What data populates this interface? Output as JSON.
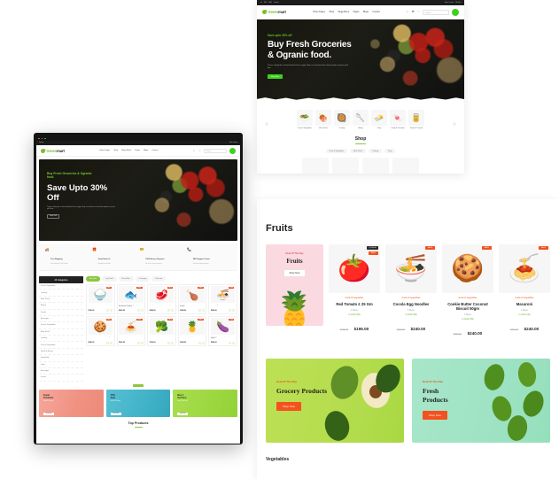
{
  "panel_top": {
    "topbar": {
      "left_items": [
        "en",
        "USD",
        "FAQ",
        "Contact"
      ],
      "right_items": [
        "Store Locator",
        "Wishlist"
      ]
    },
    "nav": {
      "brand": {
        "g": "Green",
        "rest": "mart",
        "icon": "leaf-icon"
      },
      "links": [
        "Home Pages",
        "Shop",
        "Mega Menu",
        "Pages",
        "Blogs",
        "Contact"
      ],
      "search_placeholder": "Search...",
      "icons": [
        "search-icon",
        "compare-icon",
        "wishlist-icon",
        "cart-icon"
      ]
    },
    "hero": {
      "kicker": "Save upto 30% off",
      "title": "Buy Fresh Groceries\n& Ogranic food.",
      "sub": "There's nothing like a vibrant flavorful fruit or veggie. Shop our selection of farm fresh produce at prices you'll love.",
      "button": "Shop Now"
    },
    "categories": [
      {
        "label": "Fruits &\nVegetables",
        "icon": "🥗"
      },
      {
        "label": "Meat & Fish",
        "icon": "🍖"
      },
      {
        "label": "Cooking",
        "icon": "🥘"
      },
      {
        "label": "Baking",
        "icon": "🥄"
      },
      {
        "label": "Dairy",
        "icon": "🧈"
      },
      {
        "label": "Candy &\nChocolate",
        "icon": "🍬"
      },
      {
        "label": "Frozen & Canned",
        "icon": "🥫"
      }
    ],
    "shop": {
      "title": "Shop",
      "pills": [
        "Fruits & Vegetables",
        "Meat & Fish",
        "Cooking",
        "Dairy"
      ]
    }
  },
  "panel_fruits": {
    "heading": "Fruits",
    "deal_card": {
      "kicker": "Deal Of The Day",
      "title": "Fruits",
      "button": "Shop Now",
      "art": "🍍"
    },
    "products": [
      {
        "category": "Fruits & Vegetables",
        "name": "Red Tomato  £ 25 Gm",
        "unit": "1 Piece",
        "stock": "In stock (25)",
        "old_price": "$245.00",
        "price": "$195.00",
        "badge_timer": "12:45:06",
        "badge_sale": "SALE",
        "icon": "🍅"
      },
      {
        "category": "Fruits & Vegetables",
        "name": "Cocola Egg Noodles",
        "unit": "1 Piece",
        "stock": "In stock (80)",
        "old_price": "$290.00",
        "price": "$240.00",
        "badge_sale": "SALE",
        "icon": "🍜"
      },
      {
        "category": "Fruits & Vegetables",
        "name": "Cookie Butter Coconut Biscuit 50gm",
        "unit": "1 Piece",
        "stock": "In stock (99)",
        "old_price": "$290.00",
        "price": "$240.00",
        "badge_sale": "SALE",
        "icon": "🍪"
      },
      {
        "category": "Fruits & Vegetables",
        "name": "Macaroni",
        "unit": "1 Piece",
        "stock": "In stock (40)",
        "old_price": "$290.00",
        "price": "$240.00",
        "badge_sale": "SALE",
        "icon": "🍝"
      }
    ],
    "banners": [
      {
        "kicker": "Deal Of The Day",
        "title": "Grocery Products",
        "button": "Shop Now",
        "theme": "green"
      },
      {
        "kicker": "Deal Of The Day",
        "title": "Fresh\nProducts",
        "button": "Shop Now",
        "theme": "mint"
      }
    ],
    "footer_heading": "Vegetables"
  },
  "panel_laptop": {
    "topbar": {
      "left_items": [
        "en",
        "USD",
        "FAQ",
        "Contact"
      ],
      "right_items": [
        "Store Locator",
        "Wishlist"
      ]
    },
    "nav": {
      "brand": {
        "g": "Green",
        "rest": "mart",
        "icon": "leaf-icon"
      },
      "links": [
        "Home Pages",
        "Shop",
        "Mega Menu",
        "Pages",
        "Blogs",
        "Contact"
      ],
      "search_placeholder": "Search..."
    },
    "hero": {
      "kicker": "Buy Fresh Groceries & Ogranic\nfood.",
      "title": "Save Upto 30%\nOff",
      "sub": "There's nothing like a vibrant flavorful fruit or veggie. Shop our selection of farm fresh produce at prices you'll love.",
      "button": "Shop Now"
    },
    "features": [
      {
        "icon": "🚚",
        "title": "Free Shipping",
        "sub": "Free shipping on all US order"
      },
      {
        "icon": "🎁",
        "title": "Great Deals of",
        "sub": "Everyday fresh deals"
      },
      {
        "icon": "💳",
        "title": "100% Secure Payment",
        "sub": "We ensure secure payment"
      },
      {
        "icon": "📞",
        "title": "24/7 Support Center",
        "sub": "Dedicated support anytime"
      }
    ],
    "sidebar": {
      "header": "All Categories",
      "items": [
        "Fruits & Vegetables",
        "Cooking",
        "Meat & Fish",
        "Bakery",
        "Snacks",
        "Beverages",
        "Fruits & Vegetables",
        "Meat & Fish",
        "Cooking",
        "Fruits & Vegetables",
        "Health & Beauty",
        "Household",
        "Dairy",
        "Beverages",
        "Frozen"
      ]
    },
    "tabs": [
      {
        "label": "New Item",
        "active": true
      },
      {
        "label": "Top Rated",
        "active": false
      },
      {
        "label": "Best Seller",
        "active": false
      },
      {
        "label": "Campaign",
        "active": false
      },
      {
        "label": "Featured",
        "active": false
      }
    ],
    "grid_products": [
      {
        "name": "Premium Atta Rice Basmati (Smaller)",
        "price": "$195.00",
        "badge": "SALE",
        "icon": "🍚"
      },
      {
        "name": "Green Fish (L Big) 1 Kg (Avg 1) Per Box Before Cleaning",
        "price": "$240.00",
        "badge": "SALE",
        "icon": "🐟"
      },
      {
        "name": "Bengali Beef Bone Boneless 1 Kg Box",
        "price": "$240.00",
        "badge": "SALE",
        "icon": "🥩"
      },
      {
        "name": "Boneless Chicken Breast Boneless 1 Kg Box",
        "price": "$240.00",
        "badge": "SALE",
        "icon": "🍗"
      },
      {
        "name": "Cocola Egg Noodles",
        "price": "$290.00",
        "badge": "SALE",
        "icon": "🍜"
      },
      {
        "name": "Cookie Butter Coconut Biscuit 50gm",
        "price": "$240.00",
        "badge": "SALE",
        "icon": "🍪"
      },
      {
        "name": "Macaroni",
        "price": "$240.00",
        "badge": "SALE",
        "icon": "🍝"
      },
      {
        "name": "Broccoli",
        "price": "$190.00",
        "badge": "SALE",
        "icon": "🥦"
      },
      {
        "name": "Ananas (Pineapple)",
        "price": "$240.00",
        "badge": "SALE",
        "icon": "🍍"
      },
      {
        "name": "Attar Eggplant or Brinjal Bangladeshi 1 Kg Box",
        "price": "$240.00",
        "badge": "SALE",
        "icon": "🍆"
      }
    ],
    "promos": [
      {
        "title": "Fresh\nProducts",
        "sub": "Deal Of The Day",
        "button": "Shop Now",
        "color": "#f29b8f"
      },
      {
        "title": "75%\nSale",
        "sub": "Deal Of The Day",
        "button": "Shop Now",
        "color": "#45b4c9"
      },
      {
        "title": "Buy 1\nGet One",
        "sub": "Deal Of The Day",
        "button": "Shop Now",
        "color": "#9fd94a"
      }
    ],
    "top_products_title": "Top Products"
  }
}
